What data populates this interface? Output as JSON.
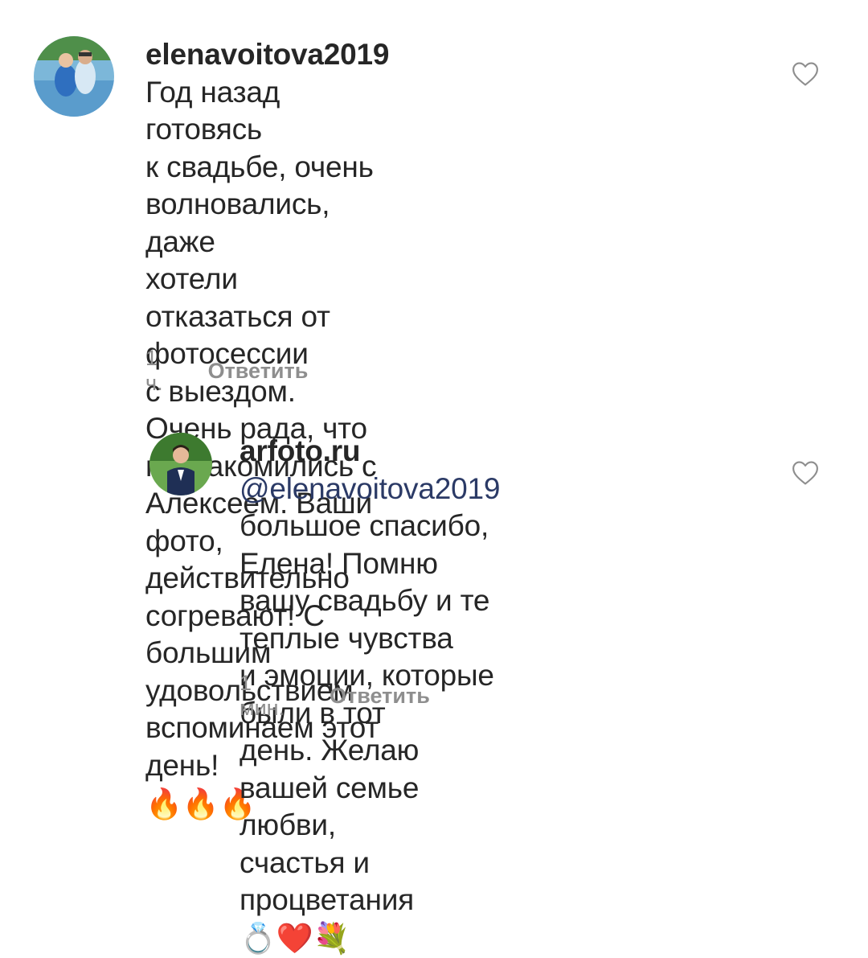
{
  "comments": [
    {
      "username": "elenavoitova2019",
      "lines": [
        "Год назад готовясь",
        "к свадьбе, очень волновались, даже",
        "хотели отказаться от фотосессии",
        "с выездом. Очень рада, что",
        "познакомились с Алексеем. Ваши фото,",
        "действительно согревают! С большим",
        "удовольствием вспоминаем этот день!"
      ],
      "emoji": "🔥🔥🔥",
      "time": "1 ч.",
      "reply_label": "Ответить",
      "icons": {
        "like": "heart-outline-icon",
        "avatar": "user-avatar-photo"
      }
    },
    {
      "username": "arfoto.ru",
      "mention": "@elenavoitova2019",
      "lines": [
        "большое спасибо, Елена! Помню",
        "вашу свадьбу и те теплые чувства",
        "и эмоции, которые были в тот",
        "день. Желаю вашей семье любви,",
        "счастья и процветания"
      ],
      "emoji": "💍❤️💐",
      "time": "1 мин.",
      "reply_label": "Ответить",
      "icons": {
        "like": "heart-outline-icon",
        "avatar": "user-avatar-photo"
      }
    }
  ],
  "colors": {
    "text": "#262626",
    "secondary": "#8e8e8e",
    "mention": "#2b3a66",
    "background": "#ffffff"
  }
}
